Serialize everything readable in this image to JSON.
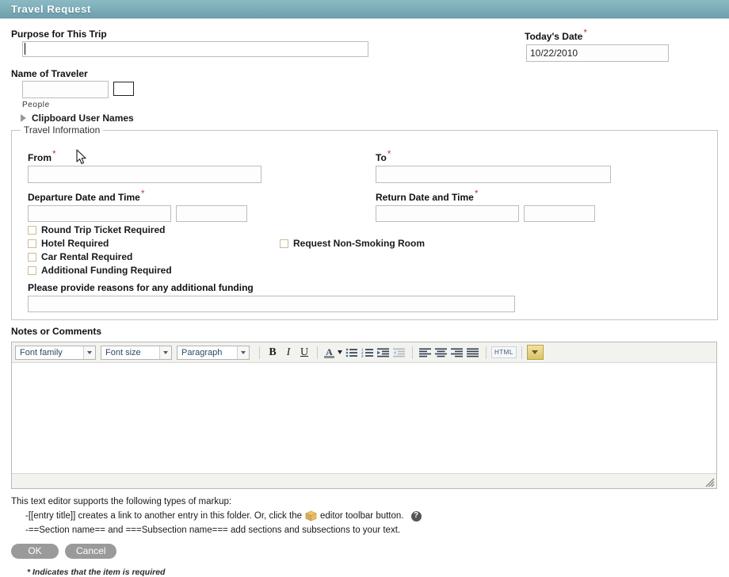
{
  "window": {
    "title": "Travel Request",
    "accent_color": "#7fb0bb",
    "required_marker": "*"
  },
  "form": {
    "purpose": {
      "label": "Purpose for This Trip",
      "value": "",
      "focused": true
    },
    "traveler": {
      "label": "Name of Traveler",
      "value": "",
      "helper": "People",
      "picker_label": ""
    },
    "clipboard": {
      "label": "Clipboard User Names",
      "expanded": false
    },
    "today_date": {
      "label": "Today's Date",
      "required": true,
      "value": "10/22/2010"
    }
  },
  "travel_information": {
    "legend": "Travel Information",
    "from": {
      "label": "From",
      "required": true,
      "value": ""
    },
    "to": {
      "label": "To",
      "required": true,
      "value": ""
    },
    "departure": {
      "label": "Departure Date and Time",
      "required": true,
      "date_value": "",
      "time_value": ""
    },
    "return": {
      "label": "Return Date and Time",
      "required": true,
      "date_value": "",
      "time_value": ""
    },
    "checkboxes": [
      {
        "label": "Round Trip Ticket Required",
        "checked": false
      },
      {
        "label": "Hotel Required",
        "checked": false
      },
      {
        "label": "Car Rental Required",
        "checked": false
      },
      {
        "label": "Additional Funding Required",
        "checked": false
      },
      {
        "label": "Request Non-Smoking Room",
        "checked": false
      }
    ],
    "reasons": {
      "label": "Please provide reasons for any additional funding",
      "value": ""
    }
  },
  "notes": {
    "label": "Notes or Comments",
    "body_value": "",
    "toolbar": {
      "font_family": "Font family",
      "font_size": "Font size",
      "paragraph": "Paragraph",
      "bold": "B",
      "italic": "I",
      "underline": "U",
      "forecolor": "A",
      "bullet_list": "unordered-list-icon",
      "number_list": "ordered-list-icon",
      "indent": "indent-icon",
      "outdent": "outdent-icon",
      "align_left": "align-left-icon",
      "align_center": "align-center-icon",
      "align_right": "align-right-icon",
      "align_justify": "align-justify-icon",
      "html": "HTML",
      "more": "chevron-down-icon"
    }
  },
  "help": {
    "intro": "This text editor supports the following types of markup:",
    "line1_before": "-[[entry title]] creates a link to another entry in this folder. Or, click the",
    "line1_after": "editor toolbar button.",
    "line2": "-==Section name== and ===Subsection name=== add sections and subsections to your text.",
    "help_icon": "?"
  },
  "actions": {
    "ok": "OK",
    "cancel": "Cancel",
    "footnote": "* Indicates that the item is required"
  }
}
